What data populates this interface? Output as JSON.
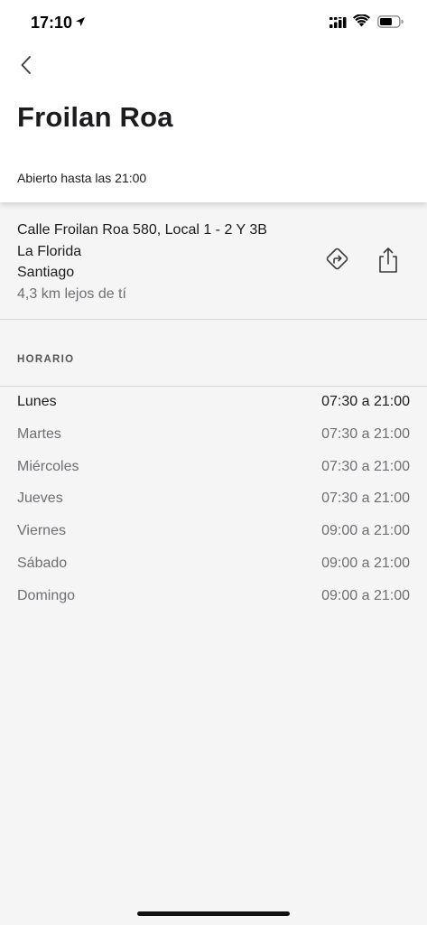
{
  "status_bar": {
    "time": "17:10",
    "icons": [
      "location-arrow-icon",
      "signal-icon",
      "wifi-icon",
      "battery-icon"
    ]
  },
  "header": {
    "back_icon": "chevron-left-icon",
    "title": "Froilan Roa",
    "open_status": "Abierto hasta las 21:00"
  },
  "location": {
    "address_line1": "Calle Froilan Roa 580, Local 1 - 2 Y 3B",
    "address_line2": "La Florida",
    "address_line3": "Santiago",
    "distance": "4,3 km lejos de tí",
    "actions": [
      "directions-icon",
      "share-icon"
    ]
  },
  "schedule": {
    "section_title": "HORARIO",
    "days": [
      {
        "day": "Lunes",
        "hours": "07:30 a 21:00",
        "today": true
      },
      {
        "day": "Martes",
        "hours": "07:30 a 21:00",
        "today": false
      },
      {
        "day": "Miércoles",
        "hours": "07:30 a 21:00",
        "today": false
      },
      {
        "day": "Jueves",
        "hours": "07:30 a 21:00",
        "today": false
      },
      {
        "day": "Viernes",
        "hours": "09:00 a 21:00",
        "today": false
      },
      {
        "day": "Sábado",
        "hours": "09:00 a 21:00",
        "today": false
      },
      {
        "day": "Domingo",
        "hours": "09:00 a 21:00",
        "today": false
      }
    ]
  },
  "colors": {
    "background": "#f5f5f5",
    "card": "#ffffff",
    "primary_text": "#1c1c1e",
    "secondary_text": "#6e6e73",
    "divider": "#d6d6d6"
  }
}
